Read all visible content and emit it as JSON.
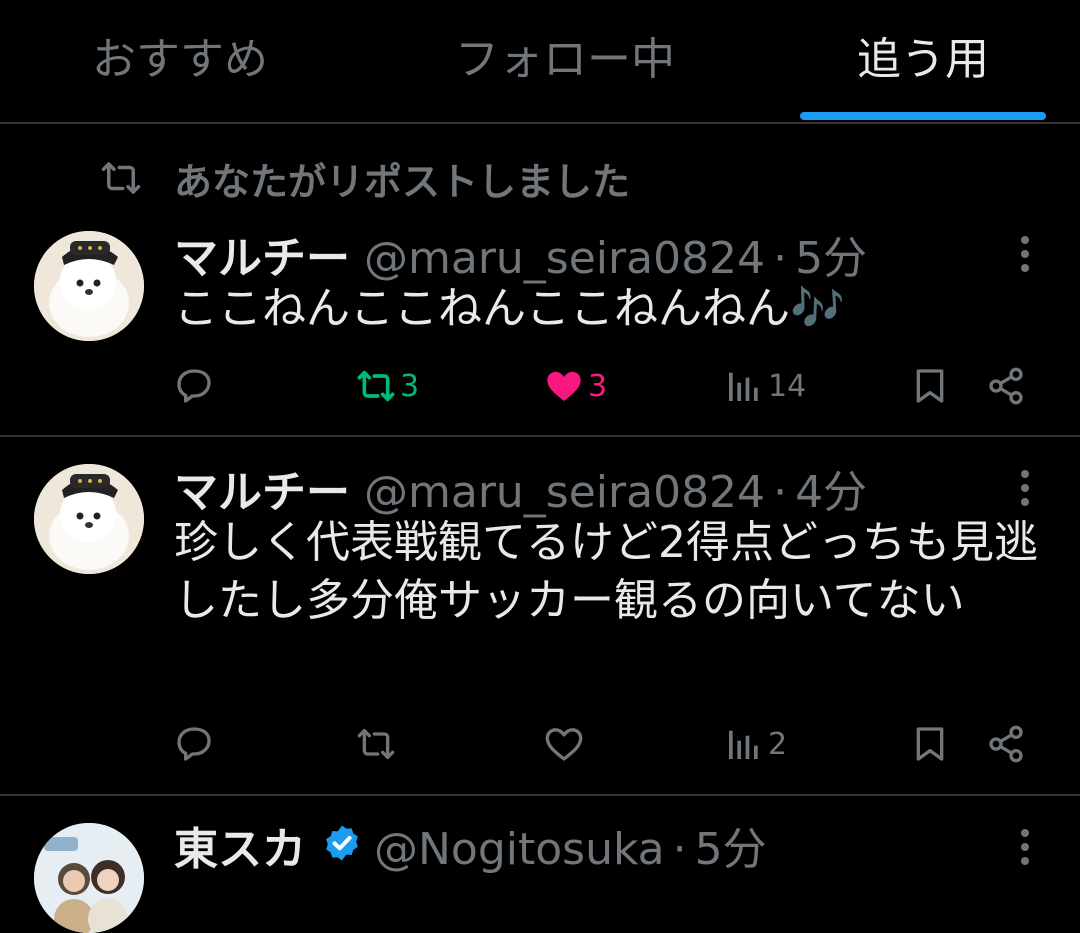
{
  "tabs": [
    {
      "label": "おすすめ"
    },
    {
      "label": "フォロー中"
    },
    {
      "label": "追う用"
    }
  ],
  "repost_notice": "あなたがリポストしました",
  "tweets": [
    {
      "name": "マルチー",
      "handle": "@maru_seira0824",
      "sep": "·",
      "time": "5分",
      "text": "ここねんここねんここねんねん🎶",
      "retweets": "3",
      "likes": "3",
      "views": "14"
    },
    {
      "name": "マルチー",
      "handle": "@maru_seira0824",
      "sep": "·",
      "time": "4分",
      "text": "珍しく代表戦観てるけど2得点どっちも見逃したし多分俺サッカー観るの向いてない",
      "retweets": "",
      "likes": "",
      "views": "2"
    },
    {
      "name": "東スカ",
      "handle": "@Nogitosuka",
      "sep": "·",
      "time": "5分",
      "verified": true
    }
  ],
  "colors": {
    "accent": "#1d9bf0",
    "retweet_active": "#00ba7c",
    "like_active": "#f91880",
    "muted": "#71767b",
    "text": "#e7e9ea",
    "divider": "#2f3336"
  }
}
